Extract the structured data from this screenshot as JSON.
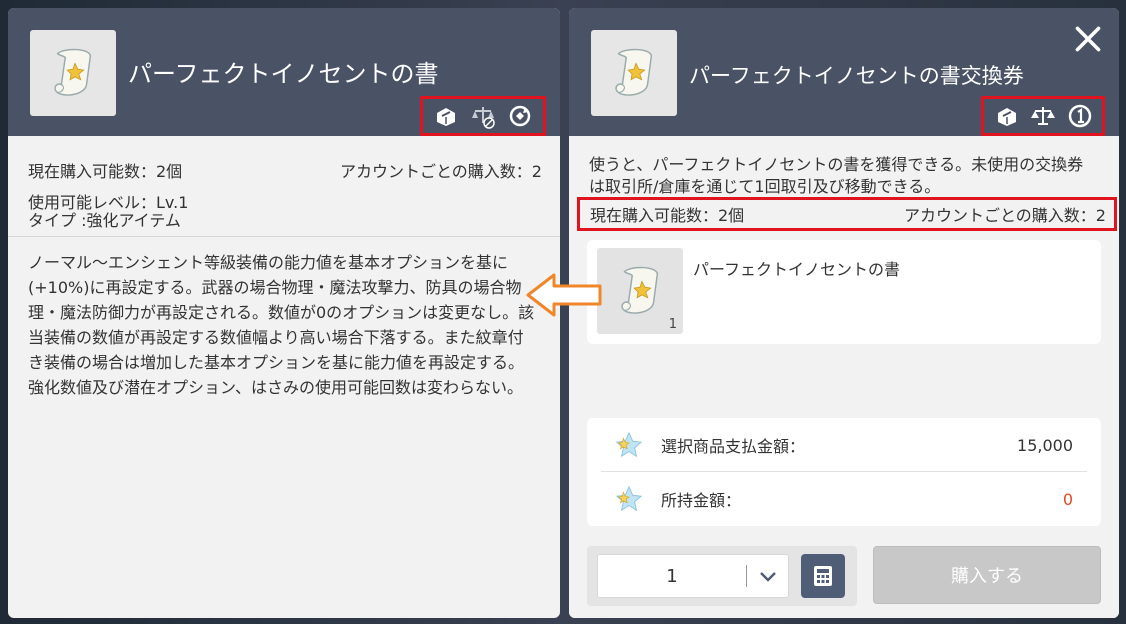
{
  "left_panel": {
    "title": "パーフェクトイノセントの書",
    "flags": [
      "exchange-icon",
      "trade-restricted-icon",
      "reset-icon"
    ],
    "purchasable_label": "現在購入可能数：2個",
    "account_purchase_label": "アカウントごとの購入数：2",
    "level_label": "使用可能レベル：Lv.1",
    "type_label": "タイプ :強化アイテム",
    "description": "ノーマル～エンシェント等級装備の能力値を基本オプションを基に(+10%)に再設定する。武器の場合物理・魔法攻撃力、防具の場合物理・魔法防御力が再設定される。数値が0のオプションは変更なし。該当装備の数値が再設定する数値幅より高い場合下落する。また紋章付き装備の場合は増加した基本オプションを基に能力値を再設定する。強化数値及び潜在オプション、はさみの使用可能回数は変わらない。"
  },
  "right_panel": {
    "title": "パーフェクトイノセントの書交換券",
    "flags": [
      "exchange-icon",
      "trade-icon",
      "one-time-icon"
    ],
    "description": "使うと、パーフェクトイノセントの書を獲得できる。未使用の交換券は取引所/倉庫を通じて1回取引及び移動できる。",
    "purchasable_label": "現在購入可能数：2個",
    "account_purchase_label": "アカウントごとの購入数：2",
    "reward": {
      "name": "パーフェクトイノセントの書",
      "count": "1"
    },
    "price": {
      "selected_label": "選択商品支払金額：",
      "selected_value": "15,000",
      "owned_label": "所持金額：",
      "owned_value": "0"
    },
    "quantity": "1",
    "buy_label": "購入する"
  },
  "colors": {
    "header": "#4a5266",
    "highlight_border": "#e0141e",
    "arrow": "#f0862a",
    "owned_zero": "#e3491d",
    "calc_button": "#4f5d77"
  }
}
